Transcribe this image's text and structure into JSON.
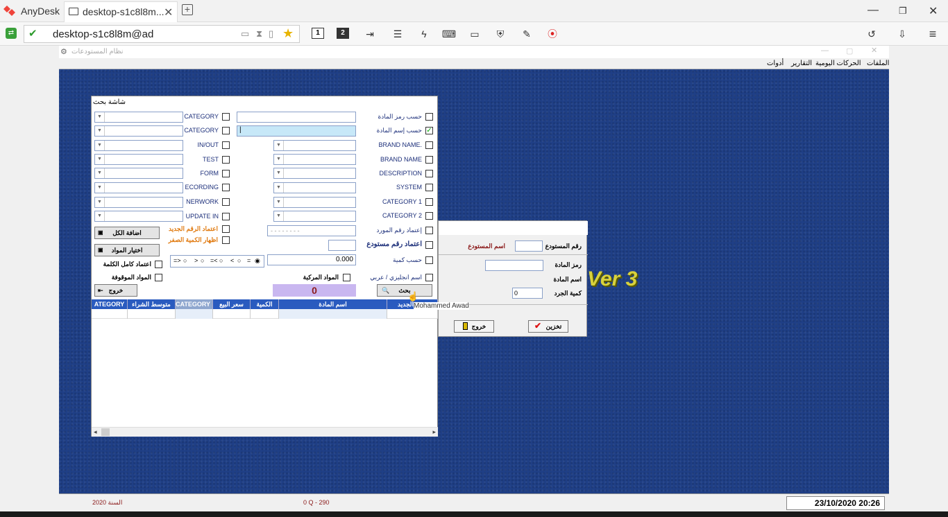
{
  "anydesk": {
    "app_name": "AnyDesk",
    "tab_title": "desktop-s1c8l8m...",
    "address": "desktop-s1c8l8m@ad",
    "toolbar_monitors": [
      "1",
      "2"
    ]
  },
  "remote_app": {
    "window_title": "نظام المستودعات",
    "menu": [
      "الملفات",
      "الحركات اليومية",
      "التقارير",
      "أدوات"
    ],
    "version_text": "Ver 3",
    "status": {
      "year": "السنة 2020",
      "q": "0 Q - 290",
      "datetime": "23/10/2020 20:26"
    }
  },
  "search_dialog": {
    "title": "شاشة بحث",
    "right_labels": [
      "حسب رمز المادة",
      "حسب إسم المادة",
      "BRAND NAME.",
      "BRAND NAME",
      "DESCRIPTION",
      "SYSTEM",
      "CATEGORY 1",
      "CATEGORY 2",
      "إعتماد رقم المورد",
      "اعتماد رقم مستودع",
      "حسب كمية",
      "اسم انجليزي / عربي"
    ],
    "left_labels": [
      "CATEGORY",
      "CATEGORY",
      "IN/OUT",
      "TEST",
      "FORM",
      "ECORDING",
      "NERWORK",
      "UPDATE IN"
    ],
    "options": {
      "adopt_new_number": "اعتماد الرقم الجديد",
      "show_zero_qty": "اظهار الكمية الصفر",
      "whole_word": "اعتماد كامل الكلمة",
      "frozen_items": "المواد الموقوفة",
      "composite_items": "المواد المركبة"
    },
    "qty_value": "0.000",
    "count_value": "0",
    "phone_mask": "- - - -   - -   - -",
    "name_input": "|",
    "operators": [
      "=>",
      ">",
      "=<",
      "<",
      "="
    ],
    "buttons": {
      "add_all": "اضافة الكل",
      "select_items": "اختيار المواد",
      "exit": "خروج",
      "search": "بحث"
    },
    "grid_columns": [
      "ATEGORY",
      "متوسط الشراء",
      "CATEGORY 1",
      "سعر البيع",
      "الكمية",
      "اسم المادة",
      "الجديد"
    ]
  },
  "entry_dialog": {
    "warehouse_no_label": "رقم المستودع",
    "warehouse_name_label": "اسم المستودع",
    "item_code_label": "رمز المادة",
    "item_name_label": "اسم المادة",
    "inventory_qty_label": "كمية الجرد",
    "inventory_qty_value": "0",
    "save_button": "تخزين",
    "exit_button": "خروج"
  },
  "tooltip": "Mohammed Awad",
  "colors": {
    "desktop_bg": "#1f3f86",
    "grid_header": "#2a5bbf",
    "count_box": "#c9b7f0",
    "highlight_input": "#c7e8f8"
  }
}
